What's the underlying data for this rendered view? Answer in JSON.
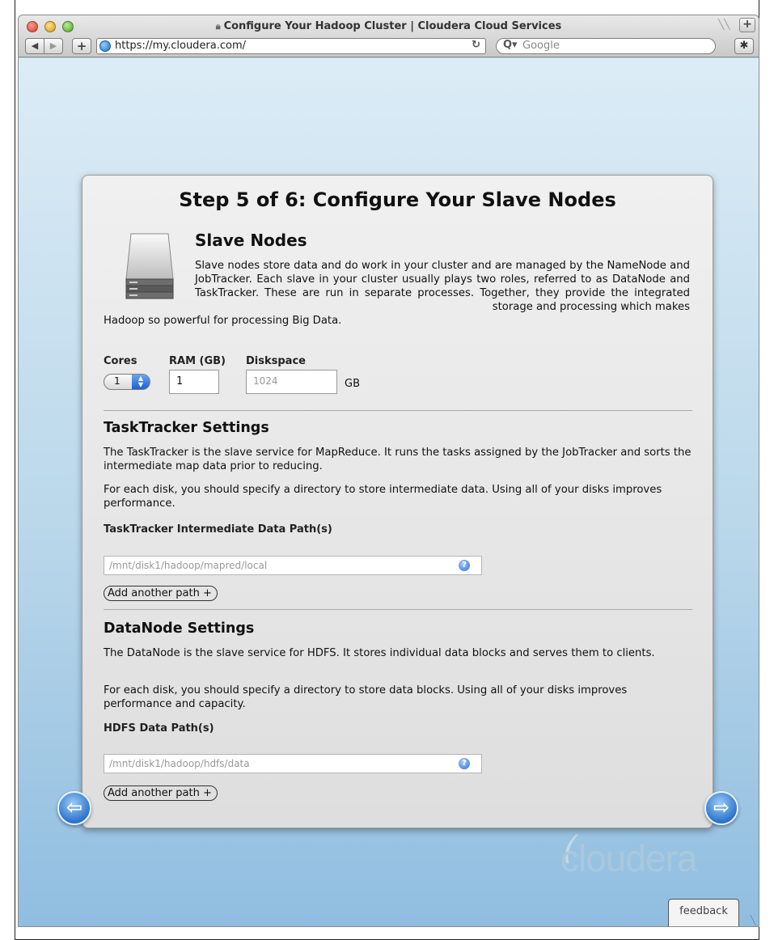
{
  "window": {
    "title": "Configure Your Hadoop Cluster | Cloudera Cloud Services",
    "url": "https://my.cloudera.com/",
    "search_placeholder": "Google"
  },
  "page": {
    "step_title": "Step 5 of 6: Configure Your Slave Nodes",
    "slave_heading": "Slave Nodes",
    "slave_description_main": "Slave nodes store data and do work in your cluster and are managed by the NameNode and JobTracker. Each slave in your cluster usually plays two roles, referred to as DataNode and TaskTracker. These are run in separate processes. Together, they provide the integrated storage and processing which makes",
    "slave_description_tail": "Hadoop so powerful for processing Big Data.",
    "resources": {
      "cores_label": "Cores",
      "cores_value": "1",
      "ram_label": "RAM (GB)",
      "ram_value": "1",
      "disk_label": "Diskspace",
      "disk_value": "1024",
      "disk_unit": "GB"
    },
    "tasktracker": {
      "heading": "TaskTracker Settings",
      "para1": "The TaskTracker is the slave service for MapReduce. It runs the tasks assigned by the JobTracker and sorts the intermediate map data prior to reducing.",
      "para2": "For each disk, you should specify a directory to store intermediate data. Using all of your disks improves performance.",
      "path_label": "TaskTracker Intermediate Data Path(s)",
      "path_placeholder": "/mnt/disk1/hadoop/mapred/local",
      "add_path_label": "Add another path +"
    },
    "datanode": {
      "heading": "DataNode Settings",
      "para1": "The DataNode is the slave service for HDFS. It stores individual data blocks and serves them to clients.",
      "para2": "For each disk, you should specify a directory to store data blocks. Using all of your disks improves performance and capacity.",
      "path_label": "HDFS Data Path(s)",
      "path_placeholder": "/mnt/disk1/hadoop/hdfs/data",
      "add_path_label": "Add another path +"
    },
    "logo_text": "cloudera",
    "feedback_label": "feedback"
  },
  "colors": {
    "background_top": "#dcecf6",
    "background_bottom": "#90bde0",
    "panel": "#e6e6e6",
    "accent_blue": "#2b74cc"
  },
  "icons": [
    "globe-icon",
    "reload-icon",
    "search-icon",
    "bug-icon",
    "hard-drive-icon",
    "help-icon",
    "back-arrow-icon",
    "next-arrow-icon"
  ]
}
